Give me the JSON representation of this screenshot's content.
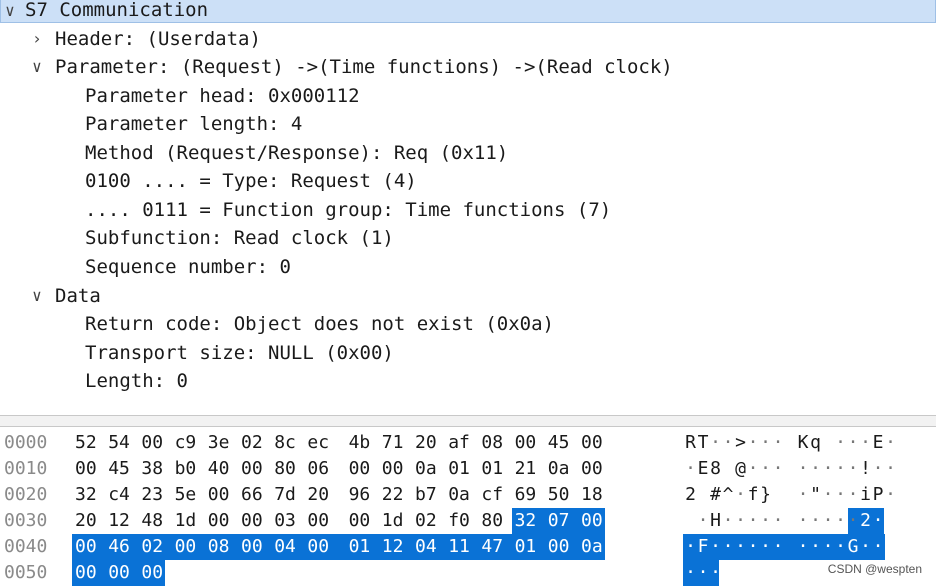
{
  "tree": [
    {
      "arrow": "∨",
      "text": "S7 Communication",
      "indent": 0,
      "selected": true
    },
    {
      "arrow": "›",
      "text": "Header: (Userdata)",
      "indent": 1
    },
    {
      "arrow": "∨",
      "text": "Parameter: (Request) ->(Time functions) ->(Read clock)",
      "indent": 1
    },
    {
      "arrow": "",
      "text": "Parameter head: 0x000112",
      "indent": 2
    },
    {
      "arrow": "",
      "text": "Parameter length: 4",
      "indent": 2
    },
    {
      "arrow": "",
      "text": "Method (Request/Response): Req (0x11)",
      "indent": 2
    },
    {
      "arrow": "",
      "text": "0100 .... = Type: Request (4)",
      "indent": 2
    },
    {
      "arrow": "",
      "text": ".... 0111 = Function group: Time functions (7)",
      "indent": 2
    },
    {
      "arrow": "",
      "text": "Subfunction: Read clock (1)",
      "indent": 2
    },
    {
      "arrow": "",
      "text": "Sequence number: 0",
      "indent": 2
    },
    {
      "arrow": "∨",
      "text": "Data",
      "indent": 1
    },
    {
      "arrow": "",
      "text": "Return code: Object does not exist (0x0a)",
      "indent": 2
    },
    {
      "arrow": "",
      "text": "Transport size: NULL (0x00)",
      "indent": 2
    },
    {
      "arrow": "",
      "text": "Length: 0",
      "indent": 2
    }
  ],
  "hex": [
    {
      "offset": "0000",
      "bytes": [
        "52",
        "54",
        "00",
        "c9",
        "3e",
        "02",
        "8c",
        "ec",
        "4b",
        "71",
        "20",
        "af",
        "08",
        "00",
        "45",
        "00"
      ],
      "ascii": "RT··>···Kq···E·"
    },
    {
      "offset": "0010",
      "bytes": [
        "00",
        "45",
        "38",
        "b0",
        "40",
        "00",
        "80",
        "06",
        "00",
        "00",
        "0a",
        "01",
        "01",
        "21",
        "0a",
        "00"
      ],
      "ascii": "·E8·@·········!··"
    },
    {
      "offset": "0020",
      "bytes": [
        "32",
        "c4",
        "23",
        "5e",
        "00",
        "66",
        "7d",
        "20",
        "96",
        "22",
        "b7",
        "0a",
        "cf",
        "69",
        "50",
        "18"
      ],
      "ascii": "2·#^·f}·\"··iP·"
    },
    {
      "offset": "0030",
      "bytes": [
        "20",
        "12",
        "48",
        "1d",
        "00",
        "00",
        "03",
        "00",
        "00",
        "1d",
        "02",
        "f0",
        "80",
        "32",
        "07",
        "00"
      ],
      "ascii": "·H·····  ····2··"
    },
    {
      "offset": "0040",
      "bytes": [
        "00",
        "46",
        "02",
        "00",
        "08",
        "00",
        "04",
        "00",
        "01",
        "12",
        "04",
        "11",
        "47",
        "01",
        "00",
        "0a"
      ],
      "ascii": "·F······ ····G···"
    },
    {
      "offset": "0050",
      "bytes": [
        "00",
        "00",
        "00"
      ],
      "ascii": "···"
    }
  ],
  "ascii_rows": [
    [
      "R",
      "T",
      "·",
      "·",
      ">",
      "·",
      "·",
      "·",
      " ",
      "K",
      "q",
      " ",
      "·",
      "·",
      "·",
      "E",
      "·"
    ],
    [
      "·",
      "E",
      "8",
      " ",
      "@",
      "·",
      "·",
      "·",
      " ",
      "·",
      "·",
      "·",
      "·",
      "·",
      "!",
      "·",
      "·"
    ],
    [
      "2",
      " ",
      "#",
      "^",
      "·",
      "f",
      "}",
      " ",
      " ",
      "·",
      "\"",
      "·",
      "·",
      "·",
      "i",
      "P",
      "·"
    ],
    [
      " ",
      "·",
      "H",
      "·",
      "·",
      "·",
      "·",
      "·",
      " ",
      "·",
      "·",
      "·",
      "·",
      "·",
      "2",
      "·",
      "·"
    ],
    [
      "·",
      "F",
      "·",
      "·",
      "·",
      "·",
      "·",
      "·",
      " ",
      "·",
      "·",
      "·",
      "·",
      "G",
      "·",
      "·",
      "·"
    ],
    [
      "·",
      "·",
      "·"
    ]
  ],
  "watermark": "CSDN @wespten"
}
